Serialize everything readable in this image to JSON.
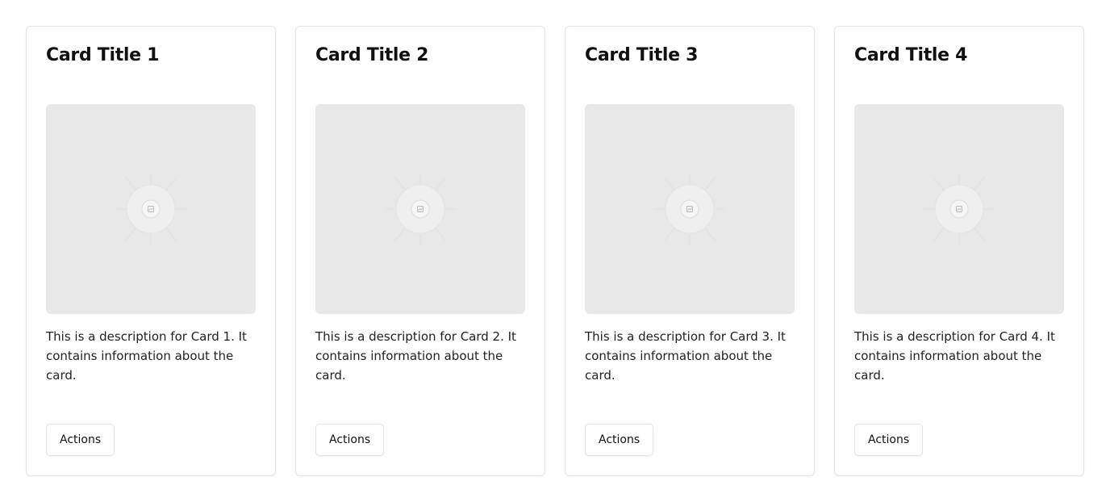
{
  "cards": [
    {
      "title": "Card Title 1",
      "image_icon": "image-placeholder-icon",
      "description": "This is a description for Card 1. It contains information about the card.",
      "action_label": "Actions"
    },
    {
      "title": "Card Title 2",
      "image_icon": "image-placeholder-icon",
      "description": "This is a description for Card 2. It contains information about the card.",
      "action_label": "Actions"
    },
    {
      "title": "Card Title 3",
      "image_icon": "image-placeholder-icon",
      "description": "This is a description for Card 3. It contains information about the card.",
      "action_label": "Actions"
    },
    {
      "title": "Card Title 4",
      "image_icon": "image-placeholder-icon",
      "description": "This is a description for Card 4. It contains information about the card.",
      "action_label": "Actions"
    }
  ],
  "colors": {
    "placeholder_bg": "#e8e8e8",
    "border": "#e4e4e7",
    "text": "#111111"
  }
}
